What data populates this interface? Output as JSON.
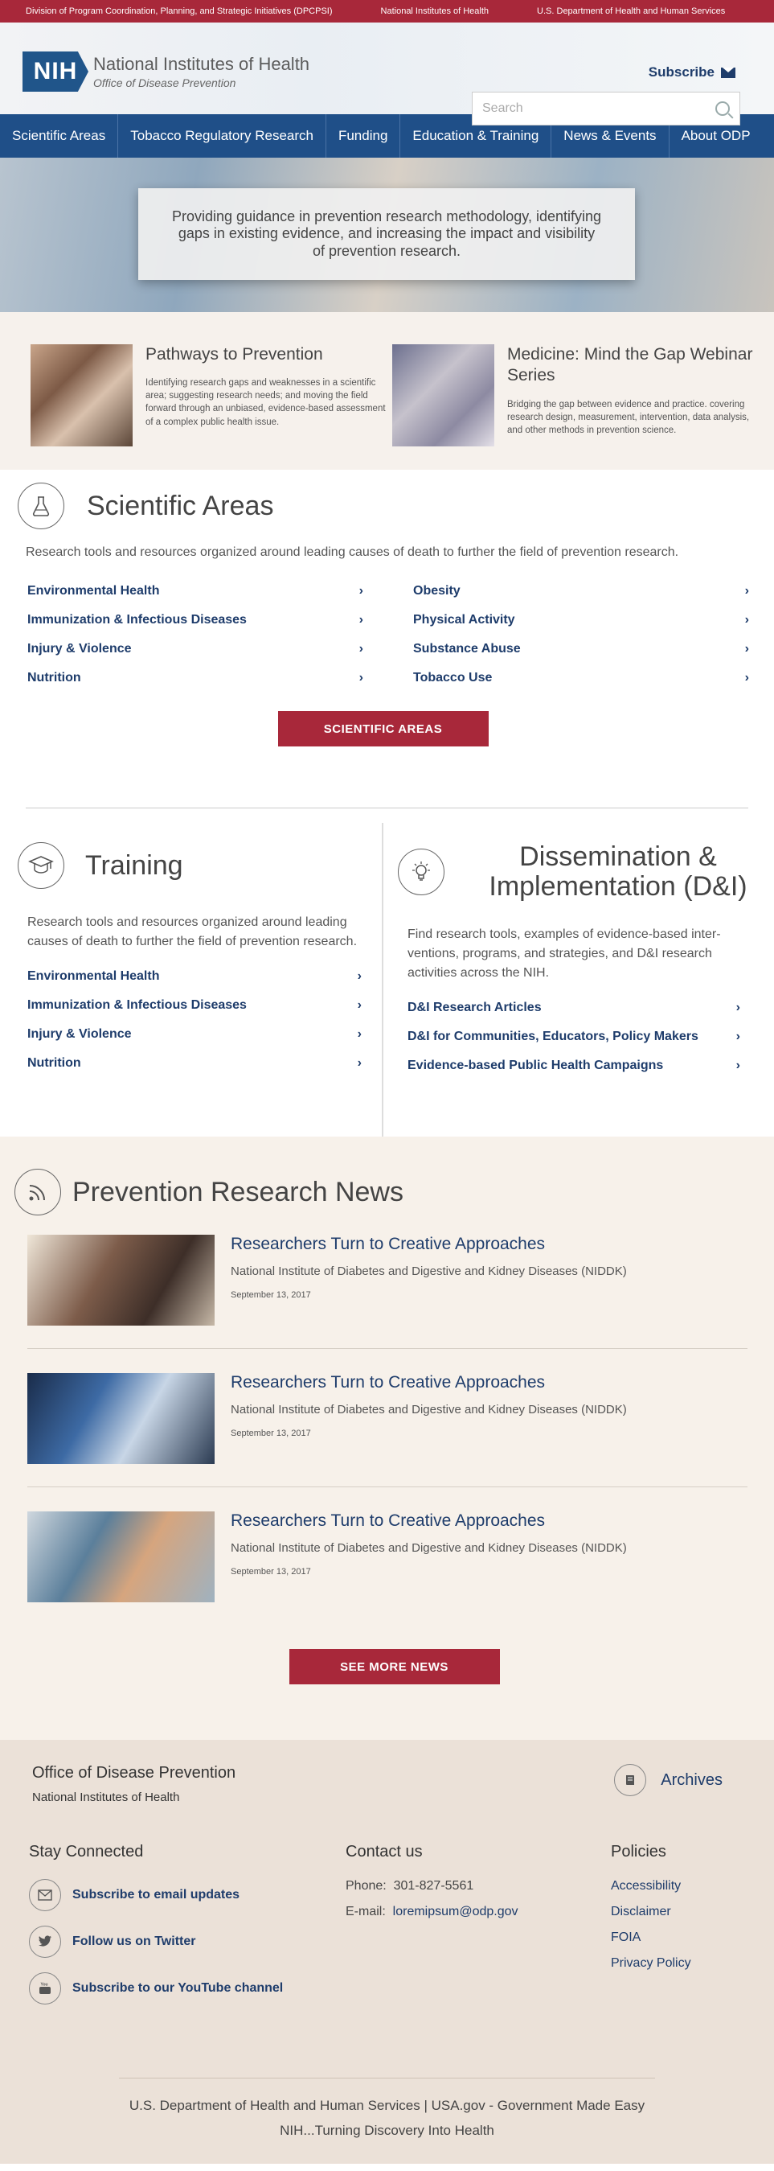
{
  "topbar": {
    "links": [
      "Division of Program Coordination, Planning, and Strategic Initiatives (DPCPSI)",
      "National Institutes of Health",
      "U.S. Department of Health and Human Services"
    ]
  },
  "header": {
    "logo_mark": "NIH",
    "logo_title": "National Institutes of Health",
    "logo_subtitle": "Office of Disease Prevention",
    "subscribe_label": "Subscribe",
    "search_placeholder": "Search"
  },
  "nav": {
    "items": [
      "Scientific Areas",
      "Tobacco Regulatory Research",
      "Funding",
      "Education & Training",
      "News & Events",
      "About ODP"
    ]
  },
  "hero": {
    "text": "Providing guidance in prevention research methodology, identifying gaps in existing evidence, and increasing the impact and visibility of prevention research."
  },
  "features": [
    {
      "title": "Pathways to Prevention",
      "desc": "Identifying research gaps and weaknesses in a scientific area; suggesting research needs; and moving the field forward through an unbiased, evidence-based assessment of a complex public health issue."
    },
    {
      "title": "Medicine: Mind the Gap Webinar Series",
      "desc": "Bridging the gap between evidence and practice. covering research design, measurement, intervention, data analysis, and other methods in prevention science."
    }
  ],
  "scientific_areas": {
    "title": "Scientific Areas",
    "desc": "Research tools and resources organized around leading causes of death to further the field of prevention research.",
    "links": [
      "Environmental Health",
      "Obesity",
      "Immunization & Infectious Diseases",
      "Physical Activity",
      "Injury & Violence",
      "Substance Abuse",
      "Nutrition",
      "Tobacco Use"
    ],
    "button": "SCIENTIFIC AREAS"
  },
  "training": {
    "title": "Training",
    "desc": "Research tools and resources organized around leading causes of death to further the field of prevention research.",
    "links": [
      "Environmental Health",
      "Immunization & Infectious Diseases",
      "Injury & Violence",
      "Nutrition"
    ]
  },
  "dissemination": {
    "title": "Dissemination & Implementation (D&I)",
    "desc": "Find research tools, examples of evidence-based inter-ventions, programs, and strategies, and D&I research activities across the NIH.",
    "links": [
      "D&I Research Articles",
      "D&I for Communities, Educators, Policy Makers",
      "Evidence-based Public Health Campaigns"
    ]
  },
  "news": {
    "title": "Prevention Research News",
    "items": [
      {
        "title": "Researchers Turn to Creative Approaches",
        "source": "National Institute of Diabetes and Digestive and Kidney Diseases (NIDDK)",
        "date": "September 13, 2017"
      },
      {
        "title": "Researchers Turn to Creative Approaches",
        "source": "National Institute of Diabetes and Digestive and Kidney Diseases (NIDDK)",
        "date": "September 13, 2017"
      },
      {
        "title": "Researchers Turn to Creative Approaches",
        "source": "National Institute of Diabetes and Digestive and Kidney Diseases (NIDDK)",
        "date": "September 13, 2017"
      }
    ],
    "button": "SEE MORE NEWS"
  },
  "footer": {
    "org_name": "Office of Disease Prevention",
    "org_parent": "National Institutes of Health",
    "archives": "Archives",
    "stay_title": "Stay Connected",
    "stay_links": [
      "Subscribe to email updates",
      "Follow us on Twitter",
      "Subscribe to our YouTube channel"
    ],
    "contact_title": "Contact us",
    "phone_label": "Phone:",
    "phone": "301-827-5561",
    "email_label": "E-mail:",
    "email": "loremipsum@odp.gov",
    "policies_title": "Policies",
    "policies": [
      "Accessibility",
      "Disclaimer",
      "FOIA",
      "Privacy Policy"
    ],
    "bottom_line1": "U.S. Department of Health and Human Services  |  USA.gov - Government Made Easy",
    "bottom_line2": "NIH...Turning Discovery Into Health"
  }
}
